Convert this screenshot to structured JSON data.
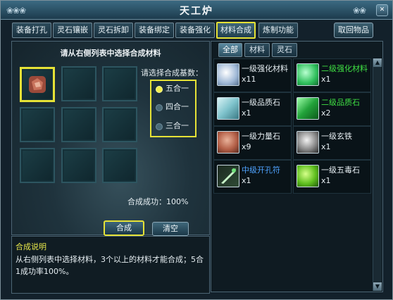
{
  "window": {
    "title": "天工炉"
  },
  "tabs": [
    "装备打孔",
    "灵石镶嵌",
    "灵石拆卸",
    "装备绑定",
    "装备强化",
    "材料合成",
    "炼制功能"
  ],
  "active_tab": 5,
  "retrieve_button": "取回物品",
  "left_panel": {
    "instruction": "请从右侧列表中选择合成材料",
    "count_title": "请选择合成基数：",
    "options": [
      "五合一",
      "四合一",
      "三合一"
    ],
    "selected_option": 0,
    "success_rate": "合成成功：100%",
    "compose_button": "合成",
    "clear_button": "清空"
  },
  "description": {
    "title": "合成说明",
    "text": "从右侧列表中选择材料，3个以上的材料才能合成；5合1成功率100%。"
  },
  "inventory": {
    "tabs": [
      "全部",
      "材料",
      "灵石"
    ],
    "active_tab": 0,
    "items": [
      {
        "name": "一级强化材料",
        "qty": "x11",
        "name_color": "#e6eef2",
        "icon": "white-crystal-icon"
      },
      {
        "name": "二级强化材料",
        "qty": "x1",
        "name_color": "#3fe043",
        "icon": "green-crystal-icon"
      },
      {
        "name": "一级品质石",
        "qty": "x1",
        "name_color": "#e6eef2",
        "icon": "cyan-stone-icon"
      },
      {
        "name": "二级品质石",
        "qty": "x2",
        "name_color": "#3fe043",
        "icon": "green-stone-icon"
      },
      {
        "name": "一级力量石",
        "qty": "x9",
        "name_color": "#e6eef2",
        "icon": "red-ore-icon"
      },
      {
        "name": "一级玄铁",
        "qty": "x1",
        "name_color": "#e6eef2",
        "icon": "iron-ore-icon"
      },
      {
        "name": "中级开孔符",
        "qty": "x1",
        "name_color": "#4fa3ff",
        "icon": "drill-rune-icon"
      },
      {
        "name": "一级五毒石",
        "qty": "x1",
        "name_color": "#e6eef2",
        "icon": "poison-stone-icon"
      }
    ]
  },
  "colors": {
    "highlight": "#e6e236",
    "uncommon": "#3fe043",
    "rare": "#4fa3ff"
  }
}
